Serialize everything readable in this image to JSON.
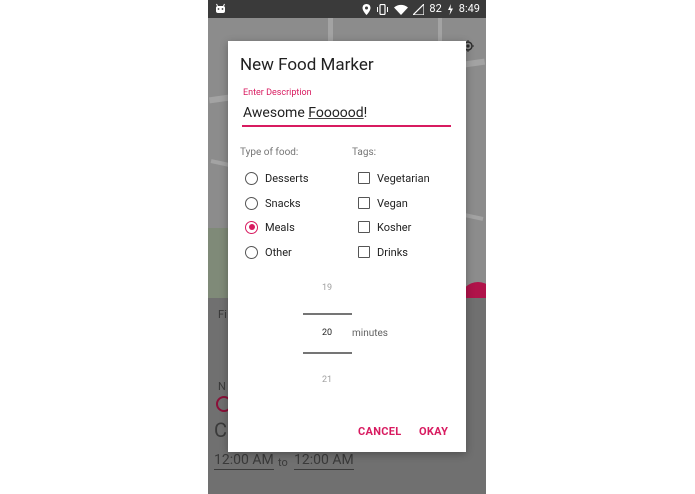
{
  "status_bar": {
    "battery": "82",
    "time": "8:49"
  },
  "background": {
    "fab_label": "Fi",
    "bottom_label": "N",
    "big_letter": "C",
    "time_from": "12:00 AM",
    "time_sep": "to",
    "time_to": "12:00 AM"
  },
  "dialog": {
    "title": "New Food Marker",
    "description": {
      "label": "Enter Description",
      "value_prefix": "Awesome ",
      "value_underlined": "Foooood",
      "value_suffix": "!"
    },
    "type_of_food": {
      "label": "Type of food:",
      "options": [
        "Desserts",
        "Snacks",
        "Meals",
        "Other"
      ],
      "selected": "Meals"
    },
    "tags": {
      "label": "Tags:",
      "options": [
        "Vegetarian",
        "Vegan",
        "Kosher",
        "Drinks"
      ]
    },
    "picker": {
      "prev": "19",
      "current": "20",
      "next": "21",
      "unit": "minutes"
    },
    "buttons": {
      "cancel": "CANCEL",
      "okay": "OKAY"
    }
  },
  "colors": {
    "accent": "#d81b60",
    "scrim": "#6e6e6e"
  },
  "icons": [
    "android-icon",
    "location-icon",
    "vibrate-icon",
    "wifi-icon",
    "signal-icon",
    "battery-icon",
    "locate-icon"
  ]
}
